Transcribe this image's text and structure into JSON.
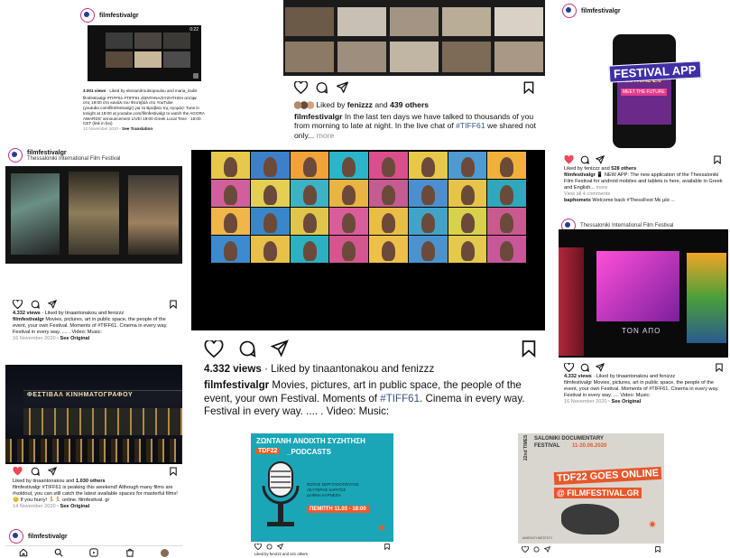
{
  "posts": {
    "p1": {
      "username": "filmfestivalgr",
      "video_time": "0:22",
      "views": "3.001 views",
      "liked": "· Liked by eleniandroutsopoulou and maria_loulis",
      "caption": "filmfestivalgr #TIFF61 #TIFF61 ΖΩΝΤΑΝΑ/ΣΥΖΗΤΗΣΗ απόψε στις 19:00 στο κανάλι του Φεστιβάλ στο YouTube (youtube.com/filmfestivalgr) για τα Βραβεία της Αγοράς! Tune in tonight at 19:00 at youtube.com/filmfestivalgr to watch the AGORA AWARDS' announcement LIVE! 19:00 Greek Local Time · 18:00 CET (link in bio)",
      "date": "12 November 2020",
      "see_translation": "· See Translation"
    },
    "p2": {
      "liked_prefix": "Liked by",
      "liked_user": "fenizzz",
      "liked_and": "and",
      "liked_others": "439 others",
      "username": "filmfestivalgr",
      "caption": "In the last ten days we have talked to thousands of you from morning to late at night. In the live chat of",
      "hashtag": "#TIFF61",
      "caption2": "we shared not only...",
      "more": "more"
    },
    "p3": {
      "username": "filmfestivalgr",
      "festival_app_label": "FESTIVAL APP",
      "festival_2_0": "FESTIVAL 2.0",
      "meet_future": "MEET THE FUTURE",
      "liked": "Liked by fenizzz and",
      "liked_others": "528 others",
      "caption": "📱 NEW APP: The new application of the Thessaloniki Film Festival for android mobiles and tablets is here, available in Greek and English...",
      "more": "more",
      "view_comments": "View all 4 comments",
      "commenter": "baphometx",
      "comment": "Welcome back #ThessFest Με μία ..."
    },
    "p4": {
      "username": "filmfestivalgr",
      "subtitle": "Thessaloniki International Film Festival",
      "views": "4.332 views",
      "liked": "· Liked by tinaantonakou and fenizzz",
      "caption": "Movies, pictures, art in public space, the people of the event, your own Festival. Moments of #TIFF61. Cinema in every way. Festival in every way. .... . Video: Music:",
      "date": "16 November 2020",
      "see_original": "· See Original"
    },
    "center": {
      "views": "4.332 views",
      "liked": "· Liked by tinaantonakou and fenizzz",
      "username": "filmfestivalgr",
      "caption": "Movies, pictures, art in public space, the people of the event, your own Festival. Moments of",
      "hashtag": "#TIFF61",
      "caption2": ". Cinema in every way. Festival in every way. .... . Video: Music:"
    },
    "p5": {
      "subtitle": "Thessaloniki International Film Festival",
      "sign_text": "TON ΑΠΟ",
      "views": "4.332 views",
      "liked": "· Liked by tinaantonakou and fenizzz",
      "caption": "filmfestivalgr Movies, pictures, art in public space, the people of the event, your own Festival. Moments of #TIFF61. Cinema in every way. Festival in every way. .... Video: Music:",
      "date": "16 November 2020",
      "see_original": "· See Original"
    },
    "p6": {
      "building_text": "ΦΕΣΤΙΒΑΛ ΚΙΝΗΜΑΤΟΓΡΑΦΟΥ",
      "liked": "Liked by tinaantonakou and",
      "liked_others": "1.030 others",
      "caption": "filmfestivalgr #TIFF61 is peaking this weekend! Although many films are #soldout, you can still catch the latest available spaces for masterful films! 😊 If you hurry! 🏃🏃 online. filmfestival. gr",
      "date": "14 November 2020",
      "see_original": "· See Original",
      "username": "filmfestivalgr"
    },
    "p7": {
      "title": "ΖΩΝΤΑΝΗ ΑΝΟΙΧΤΗ ΣΥΖΗΤΗΣΗ",
      "tdf": "TDF22",
      "podcasts": "_PODCASTS",
      "names": [
        "ΦΩΤΗΣ ΣΕΡΓΟΥΛΟΠΟΥΛΟΣ",
        "ΛΕΥΤΕΡΗΣ ΧΑΡΙΤΟΣ",
        "ΔΑΦΝΗ ΚΑΡΝΕΖΗ"
      ],
      "date": "ΠΕΜΠΤΗ 11.03 - 18:00",
      "liked": "Liked by fenizzz and 141 others"
    },
    "p8": {
      "edition": "22nd TIMES",
      "header": "SALONIKI DOCUMENTARY",
      "festival": "FESTIVAL",
      "dates": "11-20.06.2020",
      "online": "TDF22 GOES ONLINE",
      "site": "@ FILMFESTIVAL.GR",
      "badge": "#ΜΕΝΟΥΜΕΣΠΙΤΙ"
    }
  },
  "colors": {
    "like_red": "#ed4956",
    "link_blue": "#385185",
    "zoom_dark": "#1e1e1e",
    "podcast_cyan": "#1aa6b7",
    "podcast_orange": "#ef5a28",
    "tdf_orange": "#e8572a"
  },
  "icons": [
    "heart-icon",
    "comment-icon",
    "share-icon",
    "bookmark-icon",
    "home-icon",
    "search-icon",
    "reels-icon",
    "shop-icon"
  ]
}
